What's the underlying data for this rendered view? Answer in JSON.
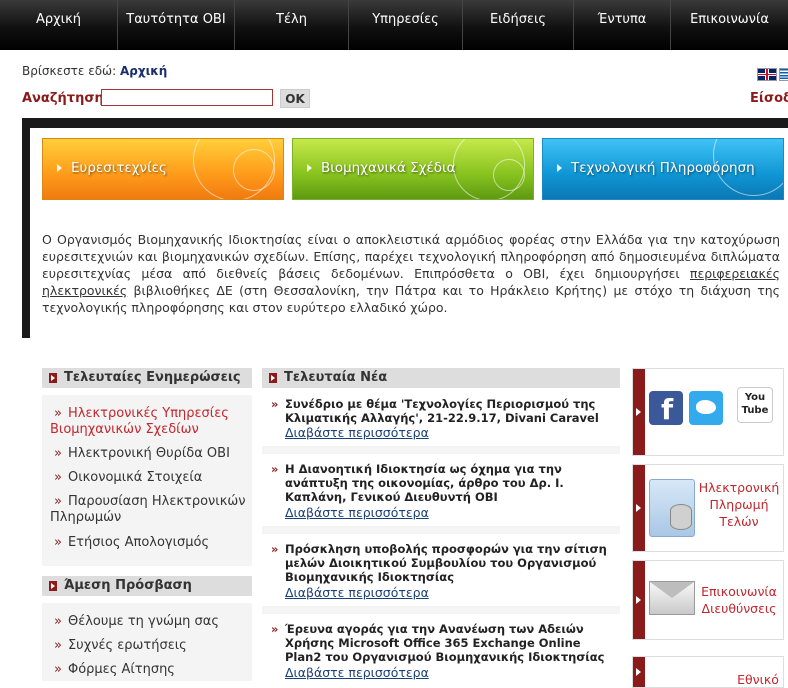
{
  "nav": [
    "Αρχική",
    "Ταυτότητα ΟΒΙ",
    "Τέλη",
    "Υπηρεσίες",
    "Ειδήσεις",
    "Έντυπα",
    "Επικοινωνία"
  ],
  "breadcrumb": {
    "prefix": "Βρίσκεστε εδώ:",
    "current": "Αρχική"
  },
  "search": {
    "label": "Αναζήτηση",
    "button": "OK"
  },
  "login": "Είσοδος",
  "banners": [
    "Ευρεσιτεχνίες",
    "Βιομηχανικά Σχέδια",
    "Τεχνολογική Πληροφόρηση"
  ],
  "intro": {
    "before": "Ο Οργανισμός Βιομηχανικής Ιδιοκτησίας είναι ο αποκλειστικά αρμόδιος φορέας στην Ελλάδα για την κατοχύρωση ευρεσιτεχνιών και βιομηχανικών σχεδίων. Επίσης, παρέχει τεχνολογική πληροφόρηση από δημοσιευμένα διπλώματα ευρεσιτεχνίας μέσα από διεθνείς βάσεις δεδομένων. Επιπρόσθετα ο ΟΒΙ, έχει δημιουργήσει ",
    "link": "περιφερειακές ηλεκτρονικές",
    "after": " βιβλιοθήκες ΔΕ (στη Θεσσαλονίκη, την Πάτρα και το Ηράκλειο Κρήτης) με στόχο τη διάχυση της τεχνολογικής πληροφόρησης και στον ευρύτερο ελλαδικό χώρο."
  },
  "updates": {
    "title": "Τελευταίες Ενημερώσεις",
    "items": [
      "Ηλεκτρονικές Υπηρεσίες Βιομηχανικών Σχεδίων",
      "Ηλεκτρονική Θυρίδα ΟΒΙ",
      "Οικονομικά Στοιχεία",
      "Παρουσίαση Ηλεκτρονικών Πληρωμών",
      "Ετήσιος Απολογισμός"
    ]
  },
  "quick_access": {
    "title": "Άμεση Πρόσβαση",
    "items": [
      "Θέλουμε τη γνώμη σας",
      "Συχνές ερωτήσεις",
      "Φόρμες Αίτησης"
    ]
  },
  "news": {
    "title": "Τελευταία Νέα",
    "more": "Διαβάστε περισσότερα",
    "items": [
      "Συνέδριο με θέμα 'Τεχνολογίες Περιορισμού της Κλιματικής Αλλαγής', 21-22.9.17, Divani Caravel",
      "Η Διανοητική Ιδιοκτησία ως όχημα για την ανάπτυξη της οικονομίας, άρθρο του Δρ. Ι. Καπλάνη, Γενικού Διευθυντή ΟΒΙ",
      "Πρόσκληση υποβολής προσφορών για την σίτιση μελών Διοικητικού Συμβουλίου του Οργανισμού Βιομηχανικής Ιδιοκτησίας",
      "Έρευνα αγοράς για την Ανανέωση των Αδειών Χρήσης Microsoft Office 365 Exchange Online Plan2 του Οργανισμού Βιομηχανικής Ιδιοκτησίας"
    ]
  },
  "right": {
    "social": [
      "facebook-icon",
      "twitter-icon",
      "youtube-icon"
    ],
    "youtube_text": "You Tube",
    "payment": "Ηλεκτρονική Πληρωμή Τελών",
    "contact": "Επικοινωνία Διευθύνσεις",
    "partial": "Εθνικό"
  }
}
